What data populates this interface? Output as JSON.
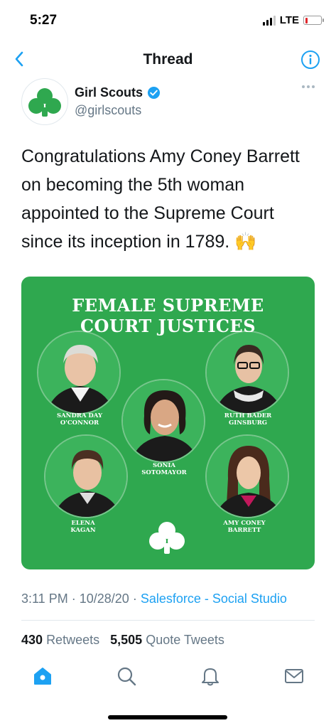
{
  "status_bar": {
    "time": "5:27",
    "network": "LTE",
    "battery_level": 0.15,
    "battery_color": "#e0262b"
  },
  "nav": {
    "back_icon": "chevron-left-icon",
    "title": "Thread",
    "info_icon": "info-icon"
  },
  "tweet": {
    "author_name": "Girl Scouts",
    "verified": true,
    "handle": "@girlscouts",
    "text": "Congratulations Amy Coney Barrett on becoming the 5th woman appointed to the Supreme Court since its inception in 1789. 🙌",
    "media": {
      "title_line1": "FEMALE SUPREME",
      "title_line2": "COURT JUSTICES",
      "justices": [
        {
          "line1": "SANDRA DAY",
          "line2": "O'CONNOR"
        },
        {
          "line1": "RUTH BADER",
          "line2": "GINSBURG"
        },
        {
          "line1": "SONIA",
          "line2": "SOTOMAYOR"
        },
        {
          "line1": "ELENA",
          "line2": "KAGAN"
        },
        {
          "line1": "AMY CONEY",
          "line2": "BARRETT"
        }
      ]
    },
    "time": "3:11 PM",
    "date": "10/28/20",
    "separator": "·",
    "source": "Salesforce - Social Studio",
    "retweets_count": "430",
    "retweets_label": "Retweets",
    "quotes_count": "5,505",
    "quotes_label": "Quote Tweets"
  },
  "tabbar": {
    "items": [
      "home-icon",
      "search-icon",
      "bell-icon",
      "mail-icon"
    ]
  },
  "colors": {
    "accent": "#1da1f2",
    "brand_green": "#2fa84f",
    "muted": "#657786"
  }
}
